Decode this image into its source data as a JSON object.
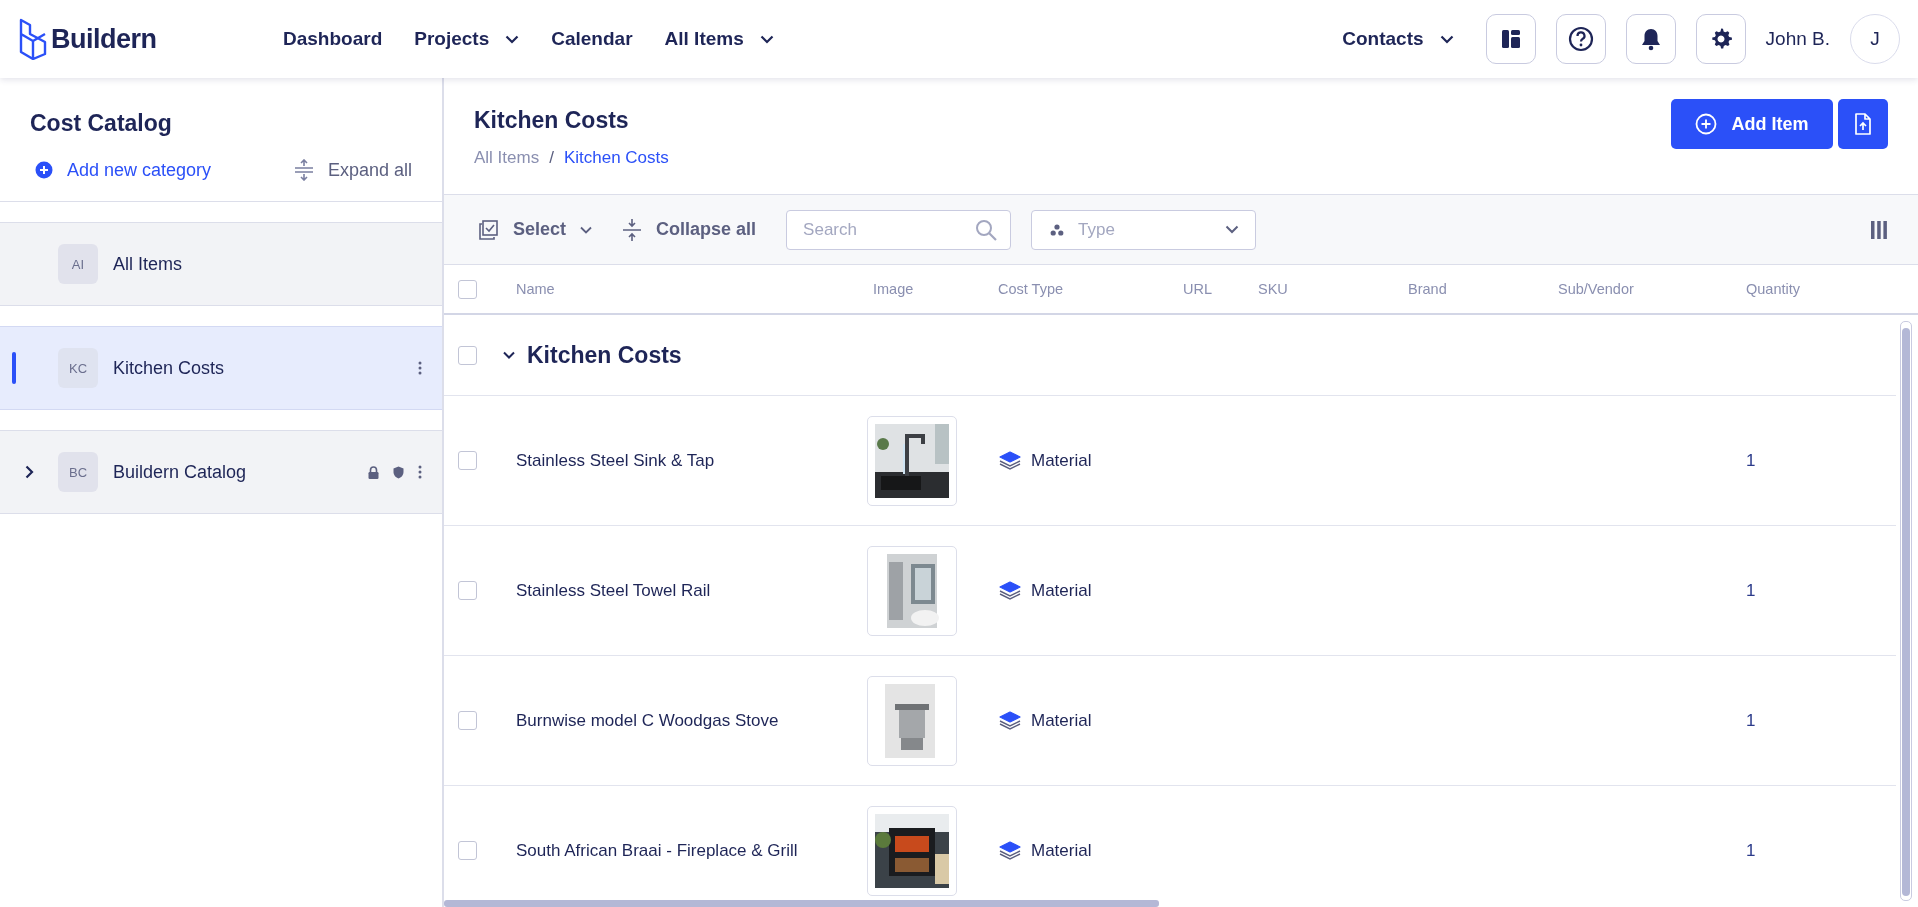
{
  "app": {
    "brand": "Buildern"
  },
  "nav": [
    {
      "label": "Dashboard",
      "dropdown": false
    },
    {
      "label": "Projects",
      "dropdown": true
    },
    {
      "label": "Calendar",
      "dropdown": false
    },
    {
      "label": "All Items",
      "dropdown": true
    }
  ],
  "header_right": {
    "contacts": "Contacts",
    "user_name": "John B.",
    "avatar_initial": "J"
  },
  "sidebar": {
    "title": "Cost Catalog",
    "add_category": "Add new category",
    "expand_all": "Expand all",
    "items": [
      {
        "badge": "AI",
        "label": "All Items",
        "selected": false,
        "expandable": false,
        "locked": false,
        "has_menu": false
      },
      {
        "badge": "KC",
        "label": "Kitchen Costs",
        "selected": true,
        "expandable": false,
        "locked": false,
        "has_menu": true
      },
      {
        "badge": "BC",
        "label": "Buildern Catalog",
        "selected": false,
        "expandable": true,
        "locked": true,
        "has_menu": true
      }
    ]
  },
  "page": {
    "title": "Kitchen Costs",
    "breadcrumb": [
      {
        "label": "All Items",
        "current": false
      },
      {
        "label": "Kitchen Costs",
        "current": true
      }
    ],
    "separator": "/",
    "add_button": "Add Item"
  },
  "toolbar": {
    "select": "Select",
    "collapse_all": "Collapse all",
    "search_placeholder": "Search",
    "type_placeholder": "Type"
  },
  "table": {
    "all_checked": false,
    "columns": [
      "Name",
      "Image",
      "Cost Type",
      "URL",
      "SKU",
      "Brand",
      "Sub/Vendor",
      "Quantity"
    ],
    "group": {
      "label": "Kitchen Costs",
      "expanded": true,
      "checked": false
    },
    "rows": [
      {
        "name": "Stainless Steel Sink & Tap",
        "cost_type": "Material",
        "quantity": "1",
        "checked": false
      },
      {
        "name": "Stainless Steel Towel Rail",
        "cost_type": "Material",
        "quantity": "1",
        "checked": false
      },
      {
        "name": "Burnwise model C Woodgas Stove",
        "cost_type": "Material",
        "quantity": "1",
        "checked": false
      },
      {
        "name": "South African Braai - Fireplace & Grill",
        "cost_type": "Material",
        "quantity": "1",
        "checked": false
      }
    ]
  }
}
